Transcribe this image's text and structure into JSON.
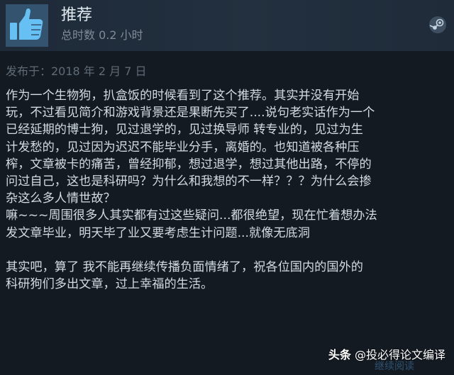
{
  "review": {
    "verdict": "推荐",
    "hours_text": "总时数 0.2 小时",
    "posted_text": "发布于：2018 年 2 月 7 日",
    "lines": [
      "作为一个生物狗，扒盒饭的时候看到了这个推荐。其实并没有开始",
      "玩，不过看见简介和游戏背景还是果断先买了....说句老实话作为一个",
      "已经延期的博士狗，见过退学的，见过换导师 转专业的，见过为生",
      "计发愁的，见过因为迟迟不能毕业分手，离婚的。也知道被各种压",
      "榨，文章被卡的痛苦，曾经抑郁，想过退学，想过其他出路，不停的",
      "问过自己，这也是科研吗？为什么和我想的不一样？？？为什么会掺",
      "杂这么多人情世故？",
      "嘛~~~周围很多人其实都有过这些疑问...都很绝望，现在忙着想办法",
      "发文章毕业，明天毕了业又要考虑生计问题...就像无底洞",
      "",
      "其实吧，算了 我不能再继续传播负面情绪了，祝各位国内的国外的",
      "科研狗们多出文章，过上幸福的生活。"
    ]
  },
  "watermark": {
    "brand": "头条",
    "handle": "@投必得论文编译"
  },
  "ghost_text": "继续阅读",
  "icons": {
    "thumb": "thumbs-up-icon",
    "steam": "steam-icon"
  },
  "colors": {
    "background": "#141a22",
    "header": "#1e2a38",
    "thumb_bg": "#34536e",
    "thumb": "#66c0f4"
  }
}
